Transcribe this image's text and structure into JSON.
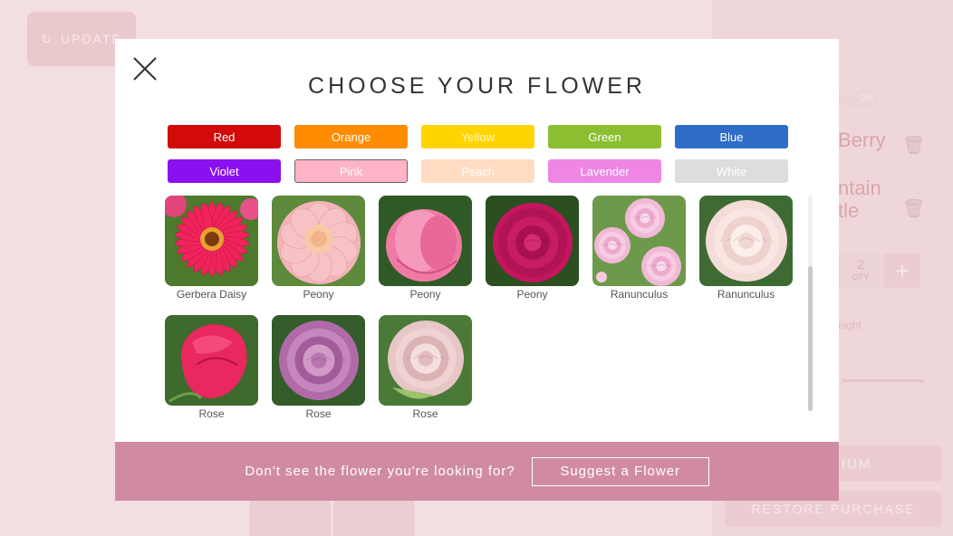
{
  "background": {
    "update_label": "UPDATE",
    "item_names": [
      "Berry",
      "ntain",
      "tle"
    ],
    "quantity": "2",
    "quantity_unit": "QTY",
    "toggle": "ON",
    "height_label": "eight",
    "premium_label": "PREMIUM",
    "restore_label": "RESTORE PURCHASE"
  },
  "modal": {
    "title": "CHOOSE YOUR FLOWER",
    "colors": [
      {
        "label": "Red",
        "bg": "#d20a0a",
        "text": "#ffffff"
      },
      {
        "label": "Orange",
        "bg": "#ff8c00",
        "text": "#ffffff"
      },
      {
        "label": "Yellow",
        "bg": "#ffd500",
        "text": "#fff6c0"
      },
      {
        "label": "Green",
        "bg": "#8cbe32",
        "text": "#ffffff"
      },
      {
        "label": "Blue",
        "bg": "#2f6ec8",
        "text": "#ffffff"
      },
      {
        "label": "Violet",
        "bg": "#8a10f0",
        "text": "#ffffff"
      },
      {
        "label": "Pink",
        "bg": "#ffb3c6",
        "text": "#ffffff"
      },
      {
        "label": "Peach",
        "bg": "#ffdcc2",
        "text": "#ffffff"
      },
      {
        "label": "Lavender",
        "bg": "#ef86e6",
        "text": "#ffffff"
      },
      {
        "label": "White",
        "bg": "#dddddd",
        "text": "#ffffff"
      }
    ],
    "selected_color": "Pink",
    "flowers": [
      {
        "name": "Gerbera Daisy",
        "kind": "gerbera"
      },
      {
        "name": "Peony",
        "kind": "peony-light"
      },
      {
        "name": "Peony",
        "kind": "peony-bud"
      },
      {
        "name": "Peony",
        "kind": "peony-magenta"
      },
      {
        "name": "Ranunculus",
        "kind": "ranunculus-multi"
      },
      {
        "name": "Ranunculus",
        "kind": "ranunculus-white"
      },
      {
        "name": "Rose",
        "kind": "rose-pink"
      },
      {
        "name": "Rose",
        "kind": "rose-mauve"
      },
      {
        "name": "Rose",
        "kind": "rose-blush"
      }
    ],
    "footer_text": "Don't see the flower you're looking for?",
    "suggest_label": "Suggest a Flower"
  },
  "colors_theme": {
    "footer": "#d08ba3",
    "background": "#f3dfe1"
  }
}
